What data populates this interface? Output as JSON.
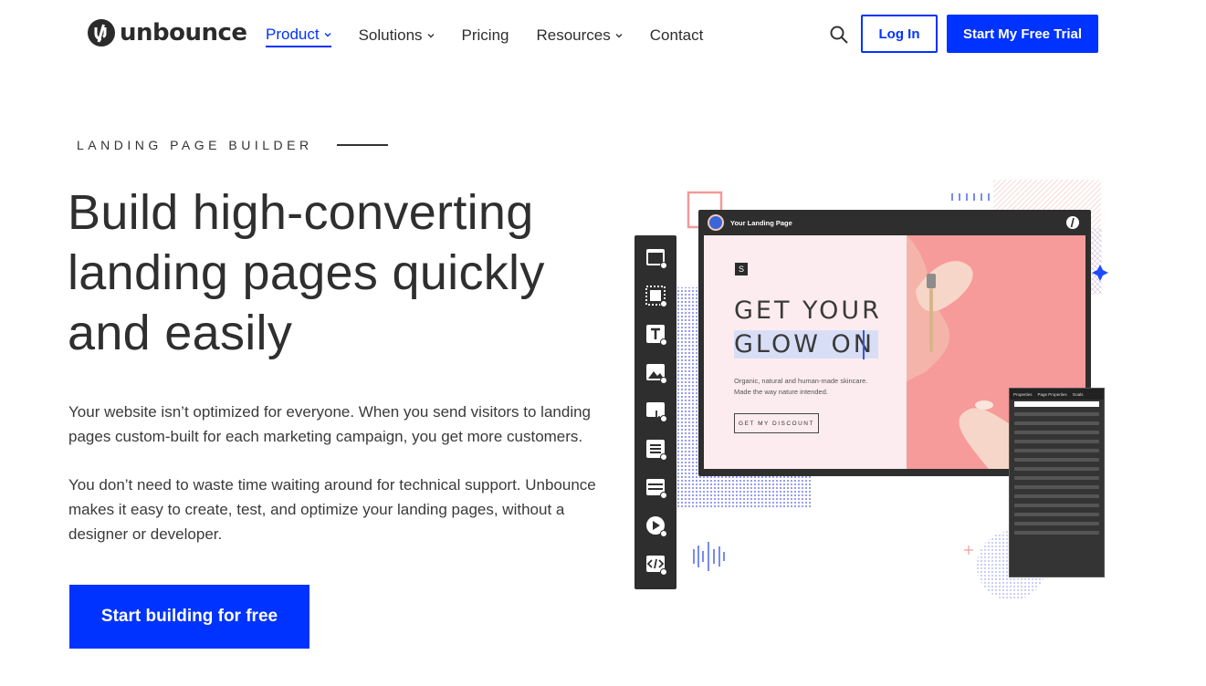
{
  "brand": {
    "name": "unbounce",
    "accent": "#0033ff"
  },
  "nav": {
    "items": [
      {
        "label": "Product",
        "dropdown": true,
        "active": true
      },
      {
        "label": "Solutions",
        "dropdown": true,
        "active": false
      },
      {
        "label": "Pricing",
        "dropdown": false,
        "active": false
      },
      {
        "label": "Resources",
        "dropdown": true,
        "active": false
      },
      {
        "label": "Contact",
        "dropdown": false,
        "active": false
      }
    ],
    "search_icon": "search-icon",
    "login_label": "Log In",
    "trial_label": "Start My Free Trial"
  },
  "hero": {
    "eyebrow": "LANDING PAGE BUILDER",
    "headline_lines": [
      "Build high-converting",
      "landing pages quickly",
      "and easily"
    ],
    "paragraph1": "Your website isn’t optimized for everyone. When you send visitors to landing pages custom-built for each marketing campaign, you get more customers.",
    "paragraph2": "You don’t need to waste time waiting around for technical support. Unbounce makes it easy to create, test, and optimize your landing pages, without a designer or developer.",
    "cta_label": "Start building for free"
  },
  "illustration": {
    "window_title": "Your Landing Page",
    "logo_letter": "S",
    "heading_line1": "GET YOUR",
    "heading_line2": "GLOW ON",
    "body_text": "Organic, natural and human-made skincare. Made the way nature intended.",
    "button_label": "GET MY DISCOUNT",
    "panel_tabs": [
      "Properties",
      "Page Properties",
      "Goals"
    ],
    "toolbar_icons": [
      "section-icon",
      "box-icon",
      "text-icon",
      "image-icon",
      "button-icon",
      "form-icon",
      "custom-html-block-icon",
      "video-icon",
      "code-icon"
    ]
  }
}
